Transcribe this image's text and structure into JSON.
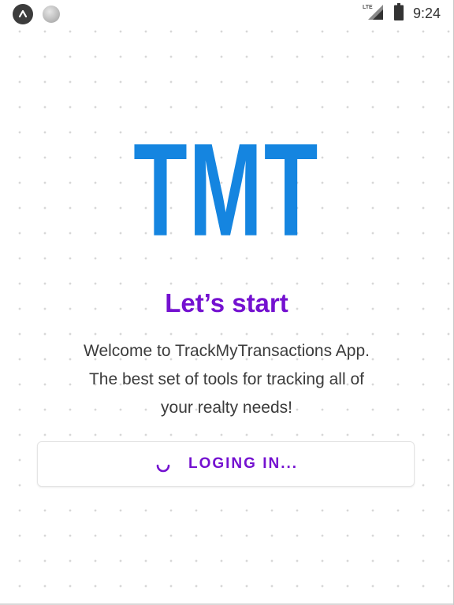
{
  "status_bar": {
    "time": "9:24",
    "network": "LTE",
    "icons": [
      "app-notification-icon",
      "circle-notification-icon",
      "lte-signal-icon",
      "battery-icon"
    ]
  },
  "logo": {
    "text": "TMT",
    "color": "#1585e0"
  },
  "headline": "Let’s start",
  "description": {
    "lines": [
      "Welcome to TrackMyTransactions App.",
      "The best set of tools for tracking all of",
      "your realty needs!"
    ]
  },
  "login_button": {
    "label": "LOGING IN...",
    "state": "loading",
    "icon": "loading-spinner-icon"
  },
  "colors": {
    "accent": "#7411d0",
    "brand": "#1585e0",
    "body_text": "#3c3c3c"
  }
}
